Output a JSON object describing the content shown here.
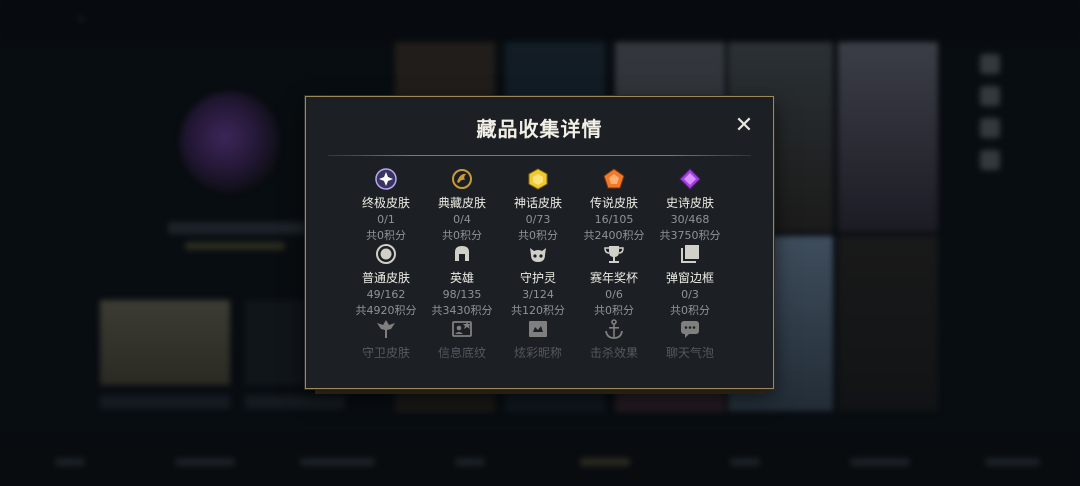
{
  "modal": {
    "title": "藏品收集详情",
    "close_symbol": "✕"
  },
  "categories": [
    {
      "name": "终极皮肤",
      "count": "0/1",
      "points": "共0积分",
      "icon": "ultimate-gem-icon",
      "color": "#b9a6f0"
    },
    {
      "name": "典藏皮肤",
      "count": "0/4",
      "points": "共0积分",
      "icon": "dragon-emblem-icon",
      "color": "#c79a3c"
    },
    {
      "name": "神话皮肤",
      "count": "0/73",
      "points": "共0积分",
      "icon": "mythic-gem-icon",
      "color": "#f0c830"
    },
    {
      "name": "传说皮肤",
      "count": "16/105",
      "points": "共2400积分",
      "icon": "legendary-gem-icon",
      "color": "#f07a2a"
    },
    {
      "name": "史诗皮肤",
      "count": "30/468",
      "points": "共3750积分",
      "icon": "epic-gem-icon",
      "color": "#a040e0"
    },
    {
      "name": "普通皮肤",
      "count": "49/162",
      "points": "共4920积分",
      "icon": "common-ring-icon",
      "color": "#d0d0c8"
    },
    {
      "name": "英雄",
      "count": "98/135",
      "points": "共3430积分",
      "icon": "helmet-icon",
      "color": "#d0d0c8"
    },
    {
      "name": "守护灵",
      "count": "3/124",
      "points": "共120积分",
      "icon": "guardian-face-icon",
      "color": "#d0d0c8"
    },
    {
      "name": "赛年奖杯",
      "count": "0/6",
      "points": "共0积分",
      "icon": "trophy-icon",
      "color": "#d0d0c8"
    },
    {
      "name": "弹窗边框",
      "count": "0/3",
      "points": "共0积分",
      "icon": "frame-icon",
      "color": "#d0d0c8"
    },
    {
      "name": "守卫皮肤",
      "count": "",
      "points": "",
      "icon": "ward-icon",
      "color": "#d0d0c8"
    },
    {
      "name": "信息底纹",
      "count": "",
      "points": "",
      "icon": "profile-card-icon",
      "color": "#d0d0c8"
    },
    {
      "name": "炫彩昵称",
      "count": "",
      "points": "",
      "icon": "nameplate-icon",
      "color": "#d0d0c8"
    },
    {
      "name": "击杀效果",
      "count": "",
      "points": "",
      "icon": "anchor-icon",
      "color": "#d0d0c8"
    },
    {
      "name": "聊天气泡",
      "count": "",
      "points": "",
      "icon": "chat-bubble-icon",
      "color": "#d0d0c8"
    }
  ]
}
